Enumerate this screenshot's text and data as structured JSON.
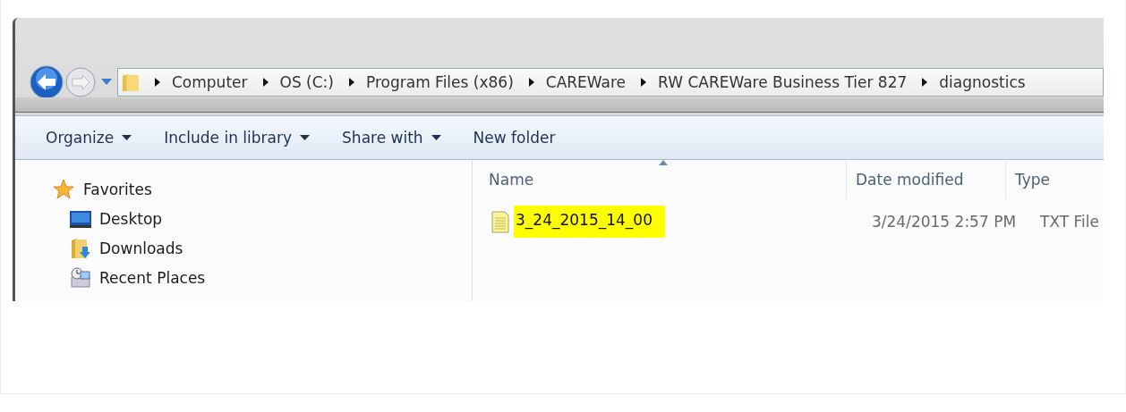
{
  "address_bar": {
    "segments": [
      "Computer",
      "OS (C:)",
      "Program Files (x86)",
      "CAREWare",
      "RW CAREWare Business Tier 827",
      "diagnostics"
    ]
  },
  "toolbar": {
    "items": [
      {
        "label": "Organize",
        "dropdown": true
      },
      {
        "label": "Include in library",
        "dropdown": true
      },
      {
        "label": "Share with",
        "dropdown": true
      },
      {
        "label": "New folder",
        "dropdown": false
      }
    ]
  },
  "navigation": {
    "items": [
      {
        "label": "Favorites",
        "kind": "favorites",
        "children": [
          {
            "label": "Desktop",
            "kind": "desktop"
          },
          {
            "label": "Downloads",
            "kind": "downloads"
          },
          {
            "label": "Recent Places",
            "kind": "recent"
          }
        ]
      }
    ]
  },
  "file_list": {
    "columns": [
      {
        "label": "Name",
        "sorted": true
      },
      {
        "label": "Date modified",
        "sorted": false
      },
      {
        "label": "Type",
        "sorted": false
      }
    ],
    "rows": [
      {
        "name": "3_24_2015_14_00",
        "date_modified": "3/24/2015 2:57 PM",
        "type": "TXT File",
        "highlighted": true
      }
    ]
  }
}
